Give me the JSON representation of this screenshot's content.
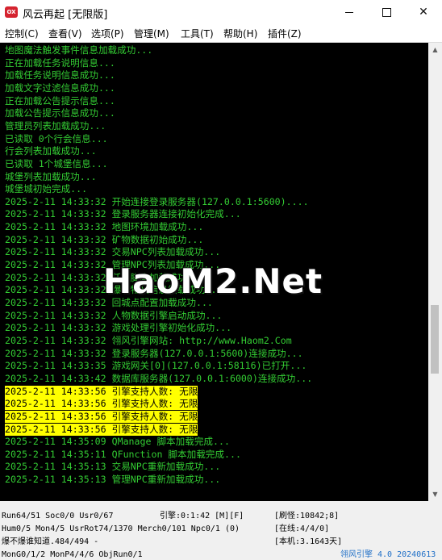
{
  "window": {
    "icon_label": "OX",
    "title": "风云再起 [无限版]"
  },
  "menu": [
    "控制(C)",
    "查看(V)",
    "选项(P)",
    "管理(M)",
    "工具(T)",
    "帮助(H)",
    "插件(Z)"
  ],
  "colors": {
    "log_bg": "#000000",
    "log_text": "#33cc33",
    "highlight_bg": "#ffff00",
    "highlight_text": "#000000"
  },
  "log": [
    {
      "text": "地图魔法触发事件信息加载成功...",
      "hl": false
    },
    {
      "text": "正在加载任务说明信息...",
      "hl": false
    },
    {
      "text": "加载任务说明信息成功...",
      "hl": false
    },
    {
      "text": "加载文字过滤信息成功...",
      "hl": false
    },
    {
      "text": "正在加载公告提示信息...",
      "hl": false
    },
    {
      "text": "加载公告提示信息成功...",
      "hl": false
    },
    {
      "text": "管理员列表加载成功...",
      "hl": false
    },
    {
      "text": "已读取 0个行会信息...",
      "hl": false
    },
    {
      "text": "行会列表加载成功...",
      "hl": false
    },
    {
      "text": "已读取 1个城堡信息...",
      "hl": false
    },
    {
      "text": "城堡列表加载成功...",
      "hl": false
    },
    {
      "text": "城堡城初始完成...",
      "hl": false
    },
    {
      "text": "2025-2-11 14:33:32 开始连接登录服务器(127.0.0.1:5600)....",
      "hl": false
    },
    {
      "text": "2025-2-11 14:33:32 登录服务器连接初始化完成...",
      "hl": false
    },
    {
      "text": "2025-2-11 14:33:32 地图环境加载成功...",
      "hl": false
    },
    {
      "text": "2025-2-11 14:33:32 矿物数据初始成功...",
      "hl": false
    },
    {
      "text": "2025-2-11 14:33:32 交易NPC列表加载成功...",
      "hl": false
    },
    {
      "text": "2025-2-11 14:33:32 管理NPC列表加载成功...",
      "hl": false
    },
    {
      "text": "2025-2-11 14:33:32 任务脚本加载成功...",
      "hl": false
    },
    {
      "text": "2025-2-11 14:33:32 爆率物品信息加载成功...",
      "hl": false
    },
    {
      "text": "2025-2-11 14:33:32 回城点配置加载成功...",
      "hl": false
    },
    {
      "text": "2025-2-11 14:33:32 人物数据引擎启动成功...",
      "hl": false
    },
    {
      "text": "2025-2-11 14:33:32 游戏处理引擎初始化成功...",
      "hl": false
    },
    {
      "text": "2025-2-11 14:33:32 翎风引擎网站: http://www.Haom2.Com",
      "hl": false
    },
    {
      "text": "2025-2-11 14:33:32 登录服务器(127.0.0.1:5600)连接成功...",
      "hl": false
    },
    {
      "text": "2025-2-11 14:33:35 游戏网关[0](127.0.0.1:58116)已打开...",
      "hl": false
    },
    {
      "text": "2025-2-11 14:33:42 数据库服务器(127.0.0.1:6000)连接成功...",
      "hl": false
    },
    {
      "text": "2025-2-11 14:33:56 引擎支持人数: 无限",
      "hl": true
    },
    {
      "text": "2025-2-11 14:33:56 引擎支持人数: 无限",
      "hl": true
    },
    {
      "text": "2025-2-11 14:33:56 引擎支持人数: 无限",
      "hl": true
    },
    {
      "text": "2025-2-11 14:33:56 引擎支持人数: 无限",
      "hl": true
    },
    {
      "text": "2025-2-11 14:35:09 QManage 脚本加载完成...",
      "hl": false
    },
    {
      "text": "2025-2-11 14:35:11 QFunction 脚本加载完成...",
      "hl": false
    },
    {
      "text": "2025-2-11 14:35:13 交易NPC重新加载成功...",
      "hl": false
    },
    {
      "text": "2025-2-11 14:35:13 管理NPC重新加载成功...",
      "hl": false
    }
  ],
  "watermark": "HaoM2.Net",
  "status": {
    "run": "Run64/51 Soc0/0 Usr0/67",
    "engine": "引擎:0:1:42 [M][F]",
    "refresh": "[刷怪:10842;8]",
    "hum": "Hum0/5 Mon4/5 UsrRot74/1370 Merch0/101 Npc0/1 (0)",
    "online": "[在线:4/4/0]",
    "note": "爆不爆谁知道.484/494 -",
    "machine": "[本机:3.1643天]",
    "mon": "MonG0/1/2 MonP4/4/6 ObjRun0/1",
    "version": "翎风引擎 4.0 20240613"
  }
}
